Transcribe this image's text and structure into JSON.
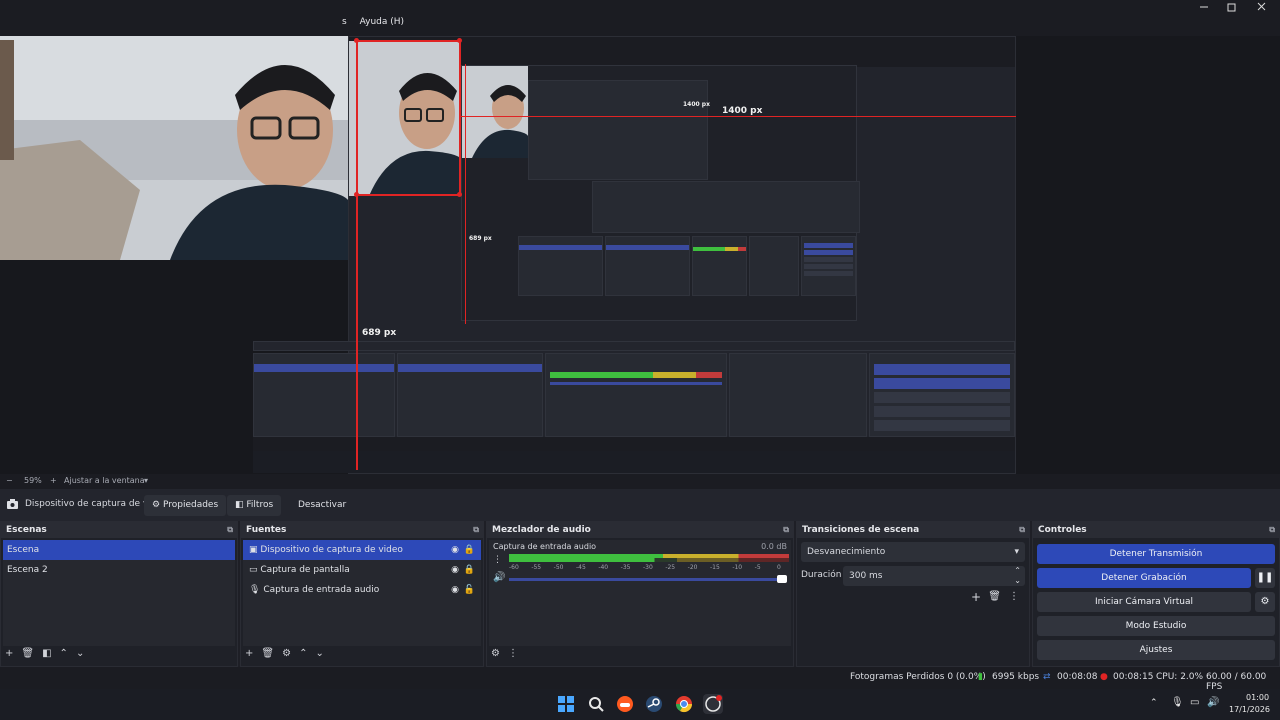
{
  "menu": {
    "partial_item": "s",
    "help": "Ayuda (H)"
  },
  "preview": {
    "label_1400": "1400 px",
    "label_689": "689 px",
    "label_689_small": "689 px",
    "label_1400_small": "1400 px"
  },
  "zoombar": {
    "minus": "−",
    "zoom": "59%",
    "plus": "+",
    "fit": "Ajustar a la ventana"
  },
  "source_toolbar": {
    "source_name": "Dispositivo de captura de v",
    "properties": "Propiedades",
    "filters": "Filtros",
    "deactivate": "Desactivar"
  },
  "scenes": {
    "title": "Escenas",
    "items": [
      "Escena",
      "Escena 2"
    ]
  },
  "sources": {
    "title": "Fuentes",
    "items": [
      {
        "label": "Dispositivo de captura de video",
        "icon": "camera-icon"
      },
      {
        "label": "Captura de pantalla",
        "icon": "monitor-icon"
      },
      {
        "label": "Captura de entrada audio",
        "icon": "microphone-icon"
      }
    ]
  },
  "mixer": {
    "title": "Mezclador de audio",
    "channel": "Captura de entrada audio",
    "db": "0.0 dB",
    "ticks": [
      "-60",
      "-55",
      "-50",
      "-45",
      "-40",
      "-35",
      "-30",
      "-25",
      "-20",
      "-15",
      "-10",
      "-5",
      "0"
    ]
  },
  "transitions": {
    "title": "Transiciones de escena",
    "selected": "Desvanecimiento",
    "duration_label": "Duración",
    "duration_value": "300 ms"
  },
  "controls": {
    "title": "Controles",
    "stop_stream": "Detener Transmisión",
    "stop_record": "Detener Grabación",
    "virtual_cam": "Iniciar Cámara Virtual",
    "studio": "Modo Estudio",
    "settings": "Ajustes"
  },
  "status": {
    "dropped": "Fotogramas Perdidos 0 (0.0%)",
    "bitrate": "6995 kbps",
    "stream_time": "00:08:08",
    "rec_time": "00:08:15",
    "cpu": "CPU: 2.0%",
    "fps": "60.00 / 60.00 FPS"
  },
  "taskbar": {
    "time": "01:00",
    "date": "17/1/2026"
  },
  "colors": {
    "accent": "#2d49b8",
    "record": "#e02424",
    "meter_green": "#3fbf3f",
    "meter_yellow": "#c9b02c",
    "meter_red": "#c23b3b"
  }
}
